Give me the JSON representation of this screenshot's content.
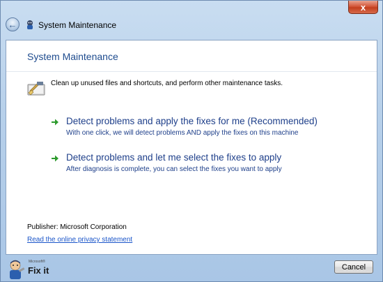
{
  "window": {
    "title": "System Maintenance",
    "close_glyph": "x",
    "back_glyph": "←"
  },
  "page": {
    "title": "System Maintenance",
    "description": "Clean up unused files and shortcuts, and perform other maintenance tasks."
  },
  "options": [
    {
      "title": "Detect problems and apply the fixes for me (Recommended)",
      "subtitle": "With one click, we will detect problems AND apply the fixes on this machine"
    },
    {
      "title": "Detect problems and let me select the fixes to apply",
      "subtitle": "After diagnosis is complete, you can select the fixes you want to apply"
    }
  ],
  "publisher": "Publisher: Microsoft Corporation",
  "privacy_link": "Read the online privacy statement",
  "footer": {
    "logo_brand": "Microsoft®",
    "logo_text": "Fix it",
    "cancel_label": "Cancel"
  },
  "icons": {
    "arrow_color": "#2e9b2e",
    "close_color": "#c94b2a",
    "title_color": "#1e4b8e"
  }
}
